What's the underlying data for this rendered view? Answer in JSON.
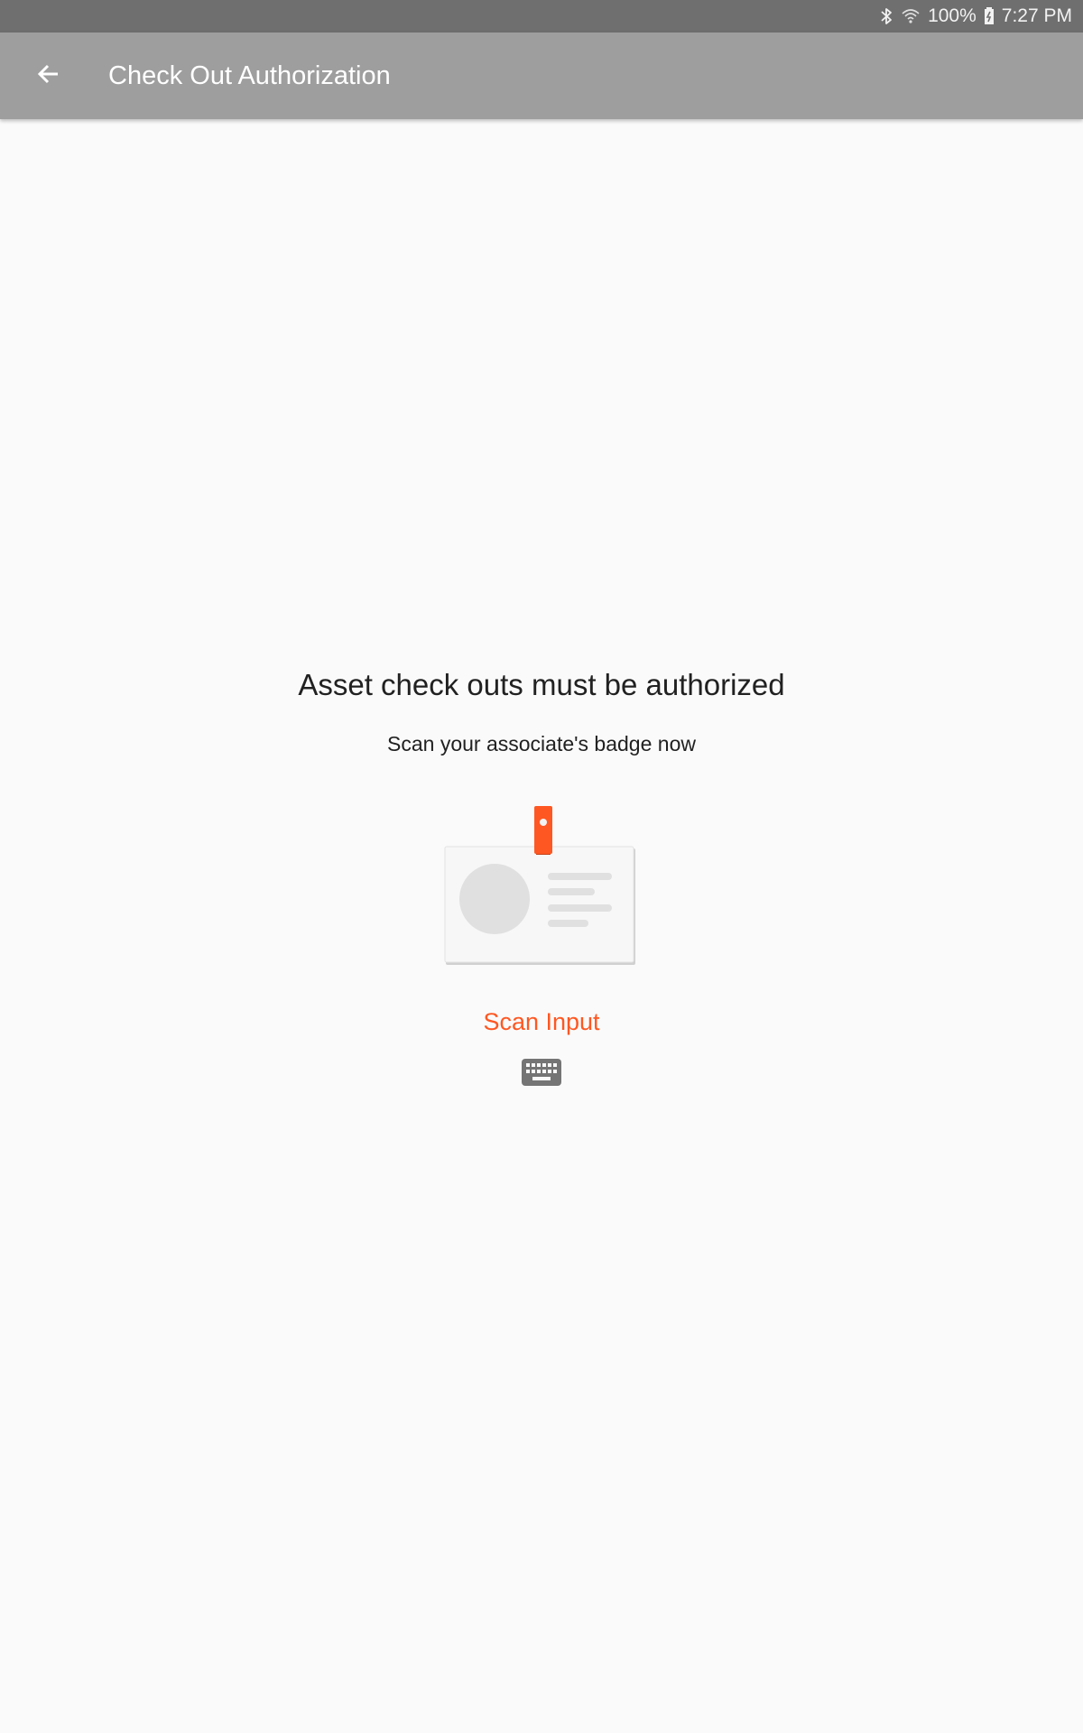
{
  "status_bar": {
    "battery_percent": "100%",
    "time": "7:27 PM",
    "icons": [
      "bluetooth-icon",
      "wifi-icon",
      "battery-charging-icon"
    ]
  },
  "toolbar": {
    "title": "Check Out Authorization",
    "back_icon": "arrow-back-icon"
  },
  "content": {
    "heading": "Asset check outs must be authorized",
    "subheading": "Scan your associate's badge now",
    "illustration_icon": "id-badge-icon",
    "scan_input_label": "Scan Input",
    "keyboard_icon": "keyboard-icon"
  },
  "colors": {
    "accent": "#ff5722",
    "toolbar_bg": "#9e9e9e",
    "status_bar_bg": "#6f6f6f",
    "background": "#fafafa",
    "text_primary": "#212121",
    "icon_gray": "#757575"
  }
}
